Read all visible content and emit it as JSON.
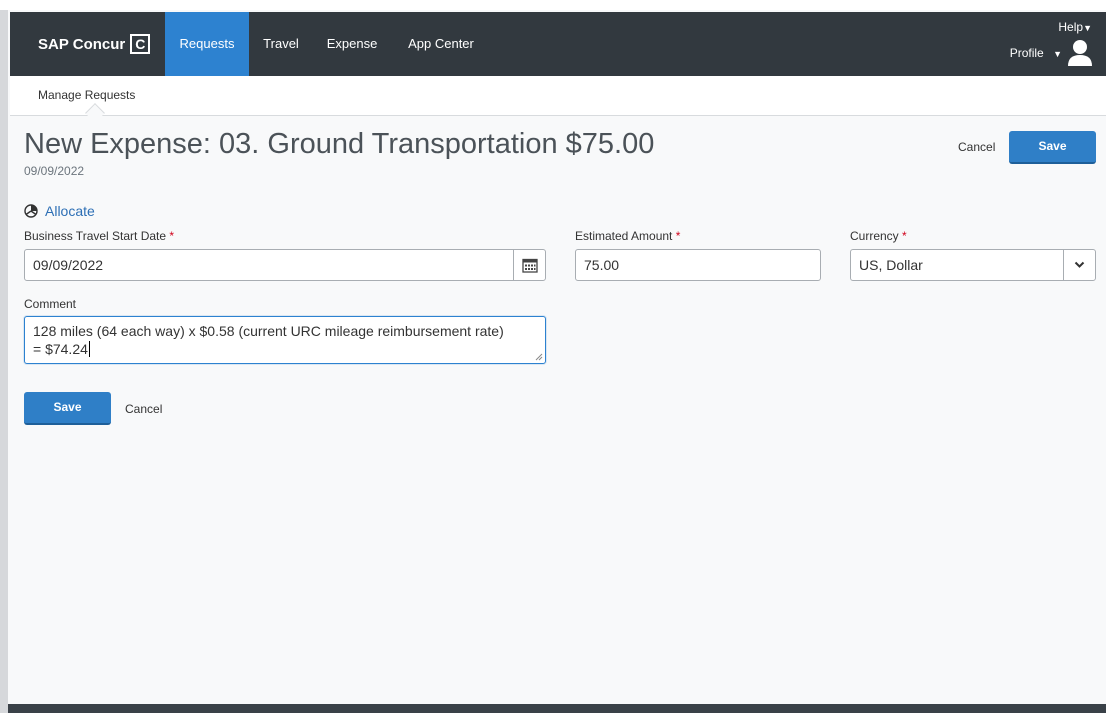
{
  "app": {
    "brand": "SAP Concur",
    "brand_mark": "C"
  },
  "nav": {
    "items": [
      {
        "label": "Requests",
        "active": true
      },
      {
        "label": "Travel",
        "active": false
      },
      {
        "label": "Expense",
        "active": false
      },
      {
        "label": "App Center",
        "active": false
      }
    ],
    "help_label": "Help",
    "profile_label": "Profile"
  },
  "subnav": {
    "item": "Manage Requests"
  },
  "header": {
    "title": "New Expense: 03. Ground Transportation $75.00",
    "date": "09/09/2022",
    "cancel_label": "Cancel",
    "save_label": "Save"
  },
  "allocate": {
    "label": "Allocate",
    "icon": "pie-chart-icon"
  },
  "form": {
    "start_date": {
      "label": "Business Travel Start Date",
      "required_mark": "*",
      "value": "09/09/2022"
    },
    "amount": {
      "label": "Estimated Amount",
      "required_mark": "*",
      "value": "75.00"
    },
    "currency": {
      "label": "Currency",
      "required_mark": "*",
      "value": "US, Dollar"
    },
    "comment": {
      "label": "Comment",
      "line1": "128 miles (64 each way) x $0.58 (current URC mileage reimbursement rate)",
      "line2": "= $74.24"
    }
  },
  "footer_actions": {
    "save_label": "Save",
    "cancel_label": "Cancel"
  },
  "colors": {
    "navbar": "#32393f",
    "accent": "#2d82d0",
    "required": "#d0021b",
    "link": "#2d6fb5"
  }
}
